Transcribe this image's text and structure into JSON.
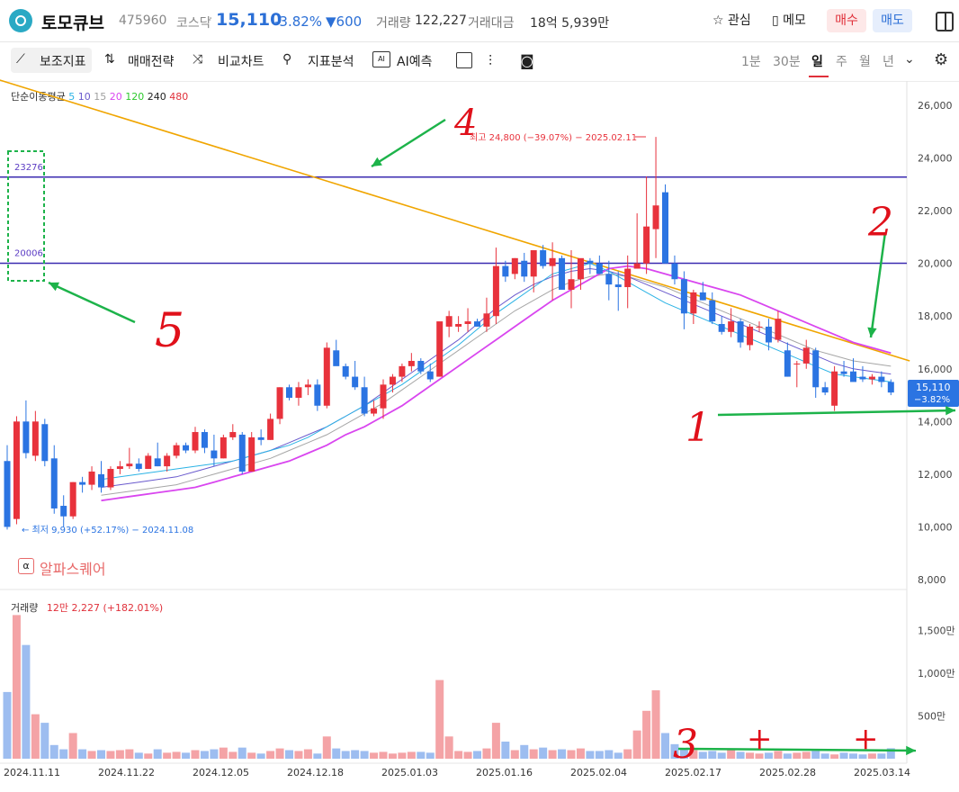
{
  "header": {
    "title": "토모큐브",
    "code": "475960",
    "market": "코스닥",
    "separator": "·",
    "price": "15,110",
    "change_pct": "-3.82%",
    "change": "▼600",
    "volume_label": "거래량",
    "volume": "122,227",
    "amount_label": "거래대금",
    "amount": "18억 5,939만",
    "fav_label": "☆ 관심",
    "memo_label": "▯ 메모",
    "buy_label": "매수",
    "sell_label": "매도"
  },
  "toolbar": {
    "indicator": "보조지표",
    "strategy": "매매전략",
    "compare": "비교차트",
    "analysis": "지표분석",
    "ai": "AI예측",
    "periods": [
      "1분",
      "30분",
      "일",
      "주",
      "월",
      "년"
    ],
    "active_period": "일",
    "indicator_icon": "indicator-icon",
    "strategy_icon": "updown-arrows-icon",
    "compare_icon": "shuffle-icon",
    "analysis_icon": "analysis-icon",
    "ai_icon": "ai-chip-icon",
    "square_icon": "square-icon",
    "candle_icon": "candle-icon",
    "camera_icon": "camera-icon",
    "gear_icon": "gear-icon",
    "chevron_icon": "chevron-down-icon"
  },
  "legend": {
    "ma_label": "단순이동평균",
    "ma": [
      {
        "label": "5",
        "color": "#2bb3e5"
      },
      {
        "label": "10",
        "color": "#6a5acd"
      },
      {
        "label": "15",
        "color": "#a0a0a0"
      },
      {
        "label": "20",
        "color": "#d946ef"
      },
      {
        "label": "120",
        "color": "#2ec92e"
      },
      {
        "label": "240",
        "color": "#222222"
      },
      {
        "label": "480",
        "color": "#e0303a"
      }
    ],
    "volume_label": "거래량",
    "volume_value": "12만 2,227 (+182.01%)"
  },
  "watermark": "알파스퀘어",
  "chart_data": {
    "type": "candlestick",
    "y_ticks": [
      "26,000",
      "24,000",
      "22,000",
      "20,000",
      "18,000",
      "16,000",
      "14,000",
      "12,000",
      "10,000",
      "8,000"
    ],
    "ylim": [
      8000,
      26000
    ],
    "volume_ticks": [
      "1,500만",
      "1,000만",
      "500만"
    ],
    "x_ticks": [
      "2024.11.11",
      "2024.11.22",
      "2024.12.05",
      "2024.12.18",
      "2025.01.03",
      "2025.01.16",
      "2025.02.04",
      "2025.02.17",
      "2025.02.28",
      "2025.03.14"
    ],
    "high_label": "최고 24,800 (−39.07%) − 2025.02.11",
    "low_label": "최저 9,930 (+52.17%) − 2024.11.08",
    "last_price_label": "15,110",
    "last_pct_label": "−3.82%",
    "hlines": [
      {
        "value": 23276,
        "label": "23276",
        "color": "#3b2bb0"
      },
      {
        "value": 20006,
        "label": "20006",
        "color": "#3b2bb0"
      }
    ],
    "trendline": {
      "color": "#f0a500",
      "from": [
        -13,
        28300
      ],
      "to": [
        96,
        16300
      ]
    },
    "candles": [
      [
        12500,
        13100,
        9900,
        10000,
        780
      ],
      [
        10300,
        14200,
        10100,
        14000,
        1680
      ],
      [
        14000,
        14800,
        12600,
        12800,
        1330
      ],
      [
        12700,
        14400,
        12500,
        14000,
        520
      ],
      [
        13900,
        14100,
        12300,
        12500,
        420
      ],
      [
        12600,
        13100,
        10500,
        10700,
        160
      ],
      [
        10800,
        11200,
        10000,
        10400,
        110
      ],
      [
        10400,
        11700,
        10300,
        11700,
        300
      ],
      [
        11700,
        11900,
        11300,
        11600,
        110
      ],
      [
        11600,
        12300,
        11400,
        12100,
        90
      ],
      [
        12000,
        12500,
        11300,
        11500,
        100
      ],
      [
        11500,
        12300,
        11400,
        12200,
        90
      ],
      [
        12200,
        12500,
        12000,
        12300,
        100
      ],
      [
        12300,
        13000,
        12200,
        12400,
        110
      ],
      [
        12400,
        12600,
        12100,
        12200,
        70
      ],
      [
        12200,
        12800,
        12200,
        12700,
        60
      ],
      [
        12600,
        13200,
        12300,
        12300,
        110
      ],
      [
        12300,
        12800,
        12100,
        12700,
        70
      ],
      [
        12700,
        13200,
        12600,
        13100,
        80
      ],
      [
        13100,
        13200,
        12800,
        12900,
        70
      ],
      [
        12900,
        13800,
        12800,
        13600,
        100
      ],
      [
        13600,
        13700,
        12800,
        13000,
        90
      ],
      [
        12900,
        13500,
        12300,
        12600,
        110
      ],
      [
        12600,
        13500,
        12600,
        13400,
        130
      ],
      [
        13400,
        13900,
        13300,
        13600,
        80
      ],
      [
        13500,
        13600,
        12000,
        12100,
        130
      ],
      [
        12100,
        13600,
        12100,
        13400,
        70
      ],
      [
        13400,
        13700,
        13100,
        13300,
        60
      ],
      [
        13300,
        14300,
        13300,
        14100,
        90
      ],
      [
        14100,
        15300,
        13900,
        15300,
        120
      ],
      [
        15300,
        15400,
        14800,
        14900,
        100
      ],
      [
        14900,
        15500,
        14600,
        15300,
        90
      ],
      [
        15300,
        15600,
        15000,
        15400,
        110
      ],
      [
        15400,
        15600,
        14400,
        14600,
        60
      ],
      [
        14600,
        17000,
        14500,
        16800,
        260
      ],
      [
        16700,
        17100,
        16400,
        16100,
        120
      ],
      [
        16100,
        16200,
        15600,
        15700,
        90
      ],
      [
        15700,
        16300,
        15200,
        15300,
        100
      ],
      [
        15300,
        15700,
        14200,
        14300,
        90
      ],
      [
        14300,
        14800,
        14200,
        14500,
        70
      ],
      [
        14500,
        15600,
        14100,
        15400,
        80
      ],
      [
        15400,
        15800,
        15100,
        15700,
        60
      ],
      [
        15700,
        16200,
        15500,
        16100,
        70
      ],
      [
        16100,
        16600,
        15900,
        16300,
        80
      ],
      [
        16300,
        16400,
        15800,
        15900,
        80
      ],
      [
        15900,
        16200,
        15500,
        15600,
        70
      ],
      [
        15700,
        17700,
        15700,
        17800,
        920
      ],
      [
        17600,
        18200,
        17200,
        18000,
        260
      ],
      [
        17600,
        18000,
        17400,
        17700,
        90
      ],
      [
        17700,
        18300,
        17400,
        17800,
        80
      ],
      [
        17800,
        17900,
        17600,
        17600,
        90
      ],
      [
        17600,
        18700,
        17400,
        18100,
        120
      ],
      [
        18000,
        20600,
        17700,
        19900,
        420
      ],
      [
        19900,
        20100,
        19300,
        19500,
        200
      ],
      [
        19600,
        20200,
        19400,
        20200,
        100
      ],
      [
        20100,
        20400,
        19300,
        19500,
        160
      ],
      [
        19500,
        20400,
        18900,
        20500,
        110
      ],
      [
        20500,
        20700,
        19800,
        19900,
        130
      ],
      [
        19900,
        20800,
        18600,
        20200,
        100
      ],
      [
        20200,
        20300,
        19200,
        19000,
        110
      ],
      [
        19000,
        20500,
        18300,
        19400,
        100
      ],
      [
        19400,
        20100,
        19000,
        20200,
        120
      ],
      [
        20100,
        20200,
        19600,
        20000,
        90
      ],
      [
        20000,
        20300,
        19600,
        19600,
        90
      ],
      [
        19600,
        20100,
        18600,
        19200,
        100
      ],
      [
        19200,
        19700,
        18200,
        19100,
        70
      ],
      [
        19100,
        20300,
        18300,
        19800,
        110
      ],
      [
        19800,
        21900,
        19800,
        20000,
        330
      ],
      [
        20000,
        23300,
        19600,
        21400,
        560
      ],
      [
        21300,
        24800,
        20200,
        22200,
        800
      ],
      [
        22700,
        23000,
        20000,
        20000,
        300
      ],
      [
        20000,
        20300,
        19200,
        19400,
        170
      ],
      [
        19400,
        19700,
        17500,
        18100,
        120
      ],
      [
        18100,
        19000,
        17700,
        18900,
        100
      ],
      [
        18900,
        19300,
        18600,
        18600,
        80
      ],
      [
        18600,
        18900,
        17700,
        17800,
        90
      ],
      [
        17700,
        18000,
        17300,
        17400,
        70
      ],
      [
        17400,
        18300,
        17200,
        17800,
        100
      ],
      [
        17800,
        17900,
        16800,
        17000,
        80
      ],
      [
        16900,
        17700,
        16700,
        17600,
        70
      ],
      [
        17600,
        17800,
        17400,
        17600,
        60
      ],
      [
        17600,
        17900,
        16700,
        17000,
        70
      ],
      [
        17100,
        18200,
        17000,
        17900,
        90
      ],
      [
        16700,
        17000,
        15700,
        15700,
        60
      ],
      [
        16200,
        16300,
        15300,
        16200,
        70
      ],
      [
        16200,
        17100,
        16000,
        16800,
        80
      ],
      [
        16700,
        16800,
        14900,
        15300,
        90
      ],
      [
        15300,
        15500,
        15000,
        15100,
        60
      ],
      [
        14600,
        16100,
        14400,
        15900,
        50
      ],
      [
        15900,
        16300,
        15700,
        15800,
        70
      ],
      [
        15900,
        16400,
        15800,
        15500,
        60
      ],
      [
        15700,
        16100,
        15500,
        15600,
        50
      ],
      [
        15600,
        15800,
        15400,
        15700,
        60
      ],
      [
        15700,
        15900,
        15300,
        15500,
        60
      ],
      [
        15500,
        15600,
        15000,
        15100,
        122
      ]
    ],
    "ma5": [
      11800,
      11900,
      12000,
      12100,
      12200,
      12300,
      12400,
      12500,
      12700,
      12900,
      13100,
      13400,
      13800,
      14200,
      14600,
      15000,
      15400,
      15900,
      16400,
      16900,
      17500,
      18100,
      18600,
      19100,
      19600,
      19800,
      20000,
      19700,
      19300,
      18900,
      18500,
      18200,
      17900,
      17600,
      17300,
      17000,
      16700,
      16400,
      16100,
      15800,
      15700,
      15600,
      15500
    ],
    "ma10": [
      11500,
      11600,
      11700,
      11800,
      11900,
      12100,
      12300,
      12500,
      12700,
      12900,
      13200,
      13500,
      13800,
      14200,
      14600,
      15100,
      15600,
      16100,
      16600,
      17100,
      17700,
      18300,
      18800,
      19200,
      19500,
      19700,
      19800,
      19700,
      19500,
      19200,
      18900,
      18600,
      18300,
      18000,
      17700,
      17400,
      17100,
      16800,
      16500,
      16200,
      16000,
      15900,
      15800
    ],
    "ma15": [
      11200,
      11300,
      11400,
      11500,
      11600,
      11800,
      12000,
      12200,
      12400,
      12600,
      12900,
      13200,
      13500,
      13900,
      14300,
      14700,
      15200,
      15700,
      16200,
      16700,
      17200,
      17700,
      18200,
      18600,
      19000,
      19300,
      19500,
      19600,
      19500,
      19300,
      19100,
      18800,
      18500,
      18200,
      17900,
      17600,
      17300,
      17000,
      16700,
      16500,
      16300,
      16200,
      16100
    ],
    "ma20": [
      11000,
      11100,
      11200,
      11300,
      11400,
      11500,
      11700,
      11900,
      12100,
      12300,
      12500,
      12800,
      13100,
      13500,
      13800,
      14200,
      14600,
      15100,
      15600,
      16100,
      16600,
      17100,
      17600,
      18100,
      18600,
      19000,
      19400,
      19800,
      19900,
      19800,
      19600,
      19400,
      19200,
      19000,
      18800,
      18500,
      18200,
      17900,
      17600,
      17300,
      17000,
      16800,
      16600
    ]
  },
  "annotations": [
    {
      "label": "1",
      "color": "#e0101a"
    },
    {
      "label": "2",
      "color": "#e0101a"
    },
    {
      "label": "3",
      "color": "#e0101a"
    },
    {
      "label": "4",
      "color": "#e0101a"
    },
    {
      "label": "5",
      "color": "#e0101a"
    },
    {
      "label": "+",
      "color": "#e0101a"
    },
    {
      "label": "+",
      "color": "#e0101a"
    }
  ]
}
